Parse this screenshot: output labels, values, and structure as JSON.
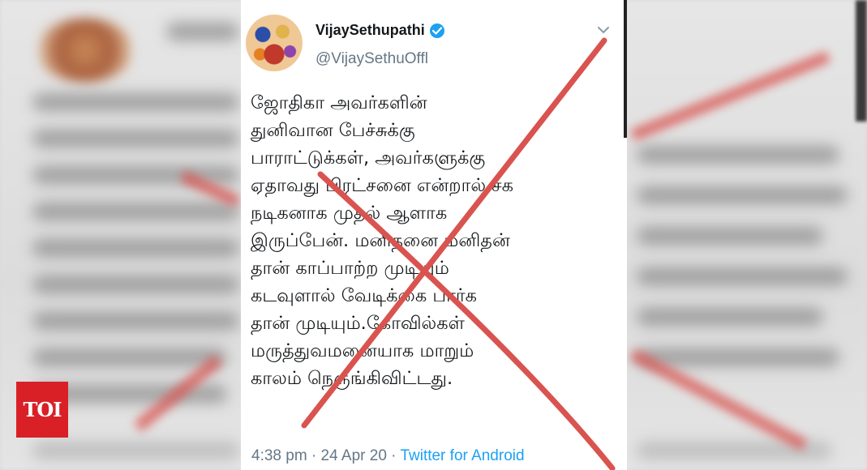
{
  "tweet": {
    "display_name": "VijaySethupathi",
    "handle": "@VijaySethuOffl",
    "text": "ஜோதிகா அவர்களின்\nதுனிவான பேச்சுக்கு\nபாராட்டுக்கள், அவர்களுக்கு\nஏதாவது பிரட்சனை என்றால் சக\nநடிகனாக முதல் ஆளாக\nஇருப்பேன். மனிதனை மனிதன்\nதான் காப்பாற்ற முடியும்\nகடவுளால் வேடிக்கை பார்க\nதான் முடியும்.கோவில்கள்\nமருத்துவமனையாக மாறும்\nகாலம் நெருங்கிவிட்டது.",
    "time": "4:38 pm",
    "separator": " · ",
    "date": "24 Apr 20",
    "source": "Twitter for Android"
  },
  "logo": {
    "text": "TOI",
    "color": "#d92027"
  },
  "colors": {
    "overlay_red": "#d9534f",
    "twitter_blue": "#1da1f2",
    "secondary_text": "#657786"
  },
  "icons": {
    "verified": "verified-badge-icon",
    "menu": "chevron-down-icon"
  }
}
